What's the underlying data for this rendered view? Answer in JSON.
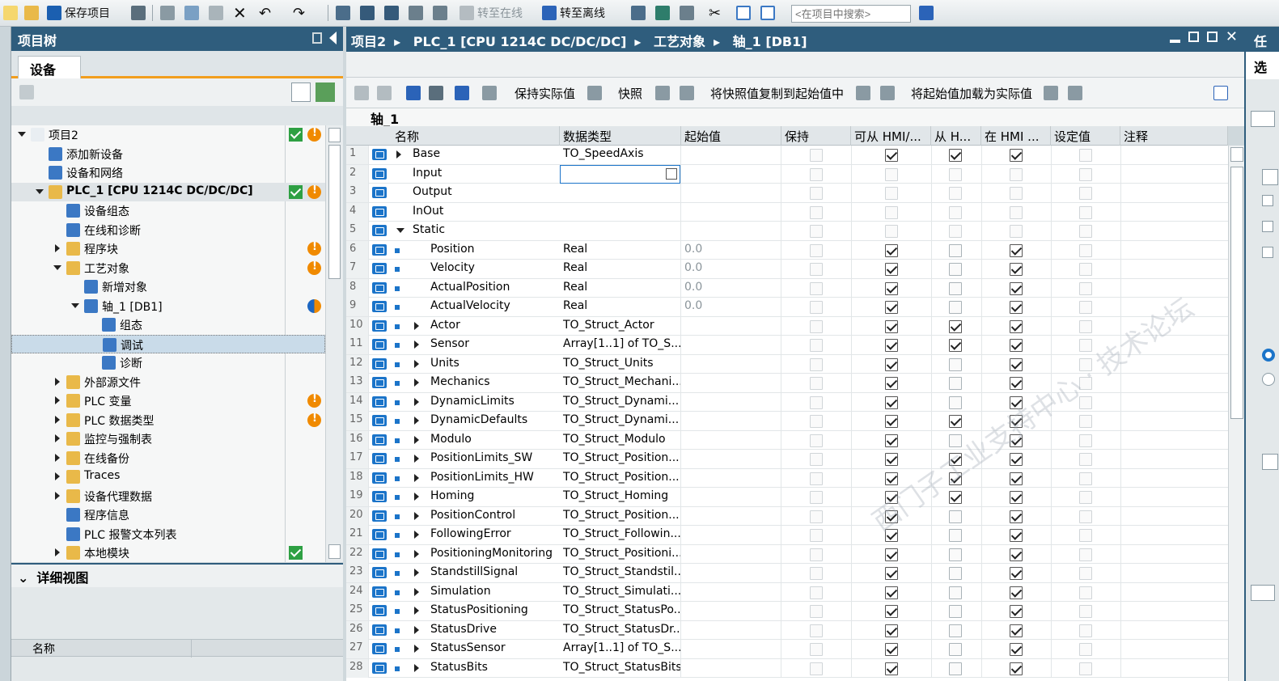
{
  "toolbar": {
    "save_project": "保存项目",
    "go_online": "转至在线",
    "go_offline": "转至离线",
    "search_placeholder": "<在项目中搜索>"
  },
  "project_tree": {
    "title": "项目树",
    "tab": "设备",
    "items": [
      {
        "label": "项目2",
        "level": 0,
        "expand": "down",
        "status": [
          "check",
          "warn"
        ]
      },
      {
        "label": "添加新设备",
        "level": 1,
        "expand": "none",
        "status": []
      },
      {
        "label": "设备和网络",
        "level": 1,
        "expand": "none",
        "status": []
      },
      {
        "label": "PLC_1 [CPU 1214C DC/DC/DC]",
        "level": 1,
        "expand": "down",
        "status": [
          "check",
          "warn"
        ]
      },
      {
        "label": "设备组态",
        "level": 2,
        "expand": "none",
        "status": []
      },
      {
        "label": "在线和诊断",
        "level": 2,
        "expand": "none",
        "status": []
      },
      {
        "label": "程序块",
        "level": 2,
        "expand": "right",
        "status": [
          "",
          "warn"
        ]
      },
      {
        "label": "工艺对象",
        "level": 2,
        "expand": "down",
        "status": [
          "",
          "warn"
        ]
      },
      {
        "label": "新增对象",
        "level": 3,
        "expand": "none",
        "status": []
      },
      {
        "label": "轴_1 [DB1]",
        "level": 3,
        "expand": "down",
        "status": [
          "",
          "half"
        ]
      },
      {
        "label": "组态",
        "level": 4,
        "expand": "none",
        "status": []
      },
      {
        "label": "调试",
        "level": 4,
        "expand": "none",
        "status": []
      },
      {
        "label": "诊断",
        "level": 4,
        "expand": "none",
        "status": []
      },
      {
        "label": "外部源文件",
        "level": 2,
        "expand": "right",
        "status": []
      },
      {
        "label": "PLC 变量",
        "level": 2,
        "expand": "right",
        "status": [
          "",
          "warn"
        ]
      },
      {
        "label": "PLC 数据类型",
        "level": 2,
        "expand": "right",
        "status": [
          "",
          "warn"
        ]
      },
      {
        "label": "监控与强制表",
        "level": 2,
        "expand": "right",
        "status": []
      },
      {
        "label": "在线备份",
        "level": 2,
        "expand": "right",
        "status": []
      },
      {
        "label": "Traces",
        "level": 2,
        "expand": "right",
        "status": []
      },
      {
        "label": "设备代理数据",
        "level": 2,
        "expand": "right",
        "status": []
      },
      {
        "label": "程序信息",
        "level": 2,
        "expand": "none",
        "status": []
      },
      {
        "label": "PLC 报警文本列表",
        "level": 2,
        "expand": "none",
        "status": []
      },
      {
        "label": "本地模块",
        "level": 2,
        "expand": "right",
        "status": [
          "check",
          ""
        ]
      }
    ],
    "selected_index": 11
  },
  "detail_view": {
    "title": "详细视图",
    "column_name": "名称"
  },
  "editor": {
    "breadcrumb": [
      "项目2",
      "PLC_1 [CPU 1214C DC/DC/DC]",
      "工艺对象",
      "轴_1 [DB1]"
    ],
    "toolbar": {
      "keep_actual": "保持实际值",
      "snapshot": "快照",
      "copy_snapshot": "将快照值复制到起始值中",
      "load_start": "将起始值加载为实际值"
    },
    "block_title": "轴_1",
    "columns": [
      "名称",
      "数据类型",
      "起始值",
      "保持",
      "可从 HMI/...",
      "从 H...",
      "在 HMI ...",
      "设定值",
      "注释"
    ],
    "rows": [
      {
        "n": "1",
        "name": "Base",
        "type": "TO_SpeedAxis",
        "start": "",
        "indent": 0,
        "expand": "right",
        "bullet": false,
        "hmi": [
          1,
          1,
          1
        ],
        "en": 1
      },
      {
        "n": "2",
        "name": "Input",
        "type": "",
        "start": "",
        "indent": 0,
        "expand": "none",
        "bullet": false,
        "hmi": [
          0,
          0,
          0
        ],
        "en": 0,
        "edit": true
      },
      {
        "n": "3",
        "name": "Output",
        "type": "",
        "start": "",
        "indent": 0,
        "expand": "none",
        "bullet": false,
        "hmi": [
          0,
          0,
          0
        ],
        "en": 0
      },
      {
        "n": "4",
        "name": "InOut",
        "type": "",
        "start": "",
        "indent": 0,
        "expand": "none",
        "bullet": false,
        "hmi": [
          0,
          0,
          0
        ],
        "en": 0
      },
      {
        "n": "5",
        "name": "Static",
        "type": "",
        "start": "",
        "indent": 0,
        "expand": "down",
        "bullet": false,
        "hmi": [
          0,
          0,
          0
        ],
        "en": 0
      },
      {
        "n": "6",
        "name": "Position",
        "type": "Real",
        "start": "0.0",
        "indent": 1,
        "expand": "none",
        "bullet": true,
        "hmi": [
          1,
          0,
          1
        ],
        "en": 1
      },
      {
        "n": "7",
        "name": "Velocity",
        "type": "Real",
        "start": "0.0",
        "indent": 1,
        "expand": "none",
        "bullet": true,
        "hmi": [
          1,
          0,
          1
        ],
        "en": 1
      },
      {
        "n": "8",
        "name": "ActualPosition",
        "type": "Real",
        "start": "0.0",
        "indent": 1,
        "expand": "none",
        "bullet": true,
        "hmi": [
          1,
          0,
          1
        ],
        "en": 1
      },
      {
        "n": "9",
        "name": "ActualVelocity",
        "type": "Real",
        "start": "0.0",
        "indent": 1,
        "expand": "none",
        "bullet": true,
        "hmi": [
          1,
          0,
          1
        ],
        "en": 1
      },
      {
        "n": "10",
        "name": "Actor",
        "type": "TO_Struct_Actor",
        "start": "",
        "indent": 1,
        "expand": "right",
        "bullet": true,
        "hmi": [
          1,
          1,
          1
        ],
        "en": 1
      },
      {
        "n": "11",
        "name": "Sensor",
        "type": "Array[1..1] of TO_S...",
        "start": "",
        "indent": 1,
        "expand": "right",
        "bullet": true,
        "hmi": [
          1,
          1,
          1
        ],
        "en": 1
      },
      {
        "n": "12",
        "name": "Units",
        "type": "TO_Struct_Units",
        "start": "",
        "indent": 1,
        "expand": "right",
        "bullet": true,
        "hmi": [
          1,
          0,
          1
        ],
        "en": 1
      },
      {
        "n": "13",
        "name": "Mechanics",
        "type": "TO_Struct_Mechani...",
        "start": "",
        "indent": 1,
        "expand": "right",
        "bullet": true,
        "hmi": [
          1,
          0,
          1
        ],
        "en": 1
      },
      {
        "n": "14",
        "name": "DynamicLimits",
        "type": "TO_Struct_Dynami...",
        "start": "",
        "indent": 1,
        "expand": "right",
        "bullet": true,
        "hmi": [
          1,
          0,
          1
        ],
        "en": 1
      },
      {
        "n": "15",
        "name": "DynamicDefaults",
        "type": "TO_Struct_Dynami...",
        "start": "",
        "indent": 1,
        "expand": "right",
        "bullet": true,
        "hmi": [
          1,
          1,
          1
        ],
        "en": 1
      },
      {
        "n": "16",
        "name": "Modulo",
        "type": "TO_Struct_Modulo",
        "start": "",
        "indent": 1,
        "expand": "right",
        "bullet": true,
        "hmi": [
          1,
          0,
          1
        ],
        "en": 1
      },
      {
        "n": "17",
        "name": "PositionLimits_SW",
        "type": "TO_Struct_Position...",
        "start": "",
        "indent": 1,
        "expand": "right",
        "bullet": true,
        "hmi": [
          1,
          1,
          1
        ],
        "en": 1
      },
      {
        "n": "18",
        "name": "PositionLimits_HW",
        "type": "TO_Struct_Position...",
        "start": "",
        "indent": 1,
        "expand": "right",
        "bullet": true,
        "hmi": [
          1,
          1,
          1
        ],
        "en": 1
      },
      {
        "n": "19",
        "name": "Homing",
        "type": "TO_Struct_Homing",
        "start": "",
        "indent": 1,
        "expand": "right",
        "bullet": true,
        "hmi": [
          1,
          1,
          1
        ],
        "en": 1
      },
      {
        "n": "20",
        "name": "PositionControl",
        "type": "TO_Struct_Position...",
        "start": "",
        "indent": 1,
        "expand": "right",
        "bullet": true,
        "hmi": [
          1,
          0,
          1
        ],
        "en": 1
      },
      {
        "n": "21",
        "name": "FollowingError",
        "type": "TO_Struct_Followin...",
        "start": "",
        "indent": 1,
        "expand": "right",
        "bullet": true,
        "hmi": [
          1,
          0,
          1
        ],
        "en": 1
      },
      {
        "n": "22",
        "name": "PositioningMonitoring",
        "type": "TO_Struct_Positioni...",
        "start": "",
        "indent": 1,
        "expand": "right",
        "bullet": true,
        "hmi": [
          1,
          0,
          1
        ],
        "en": 1
      },
      {
        "n": "23",
        "name": "StandstillSignal",
        "type": "TO_Struct_Standstil...",
        "start": "",
        "indent": 1,
        "expand": "right",
        "bullet": true,
        "hmi": [
          1,
          0,
          1
        ],
        "en": 1
      },
      {
        "n": "24",
        "name": "Simulation",
        "type": "TO_Struct_Simulati...",
        "start": "",
        "indent": 1,
        "expand": "right",
        "bullet": true,
        "hmi": [
          1,
          0,
          1
        ],
        "en": 1
      },
      {
        "n": "25",
        "name": "StatusPositioning",
        "type": "TO_Struct_StatusPo...",
        "start": "",
        "indent": 1,
        "expand": "right",
        "bullet": true,
        "hmi": [
          1,
          0,
          1
        ],
        "en": 1
      },
      {
        "n": "26",
        "name": "StatusDrive",
        "type": "TO_Struct_StatusDr...",
        "start": "",
        "indent": 1,
        "expand": "right",
        "bullet": true,
        "hmi": [
          1,
          0,
          1
        ],
        "en": 1
      },
      {
        "n": "27",
        "name": "StatusSensor",
        "type": "Array[1..1] of TO_S...",
        "start": "",
        "indent": 1,
        "expand": "right",
        "bullet": true,
        "hmi": [
          1,
          0,
          1
        ],
        "en": 1
      },
      {
        "n": "28",
        "name": "StatusBits",
        "type": "TO_Struct_StatusBits",
        "start": "",
        "indent": 1,
        "expand": "right",
        "bullet": true,
        "hmi": [
          1,
          0,
          1
        ],
        "en": 1
      }
    ]
  },
  "right_pane": {
    "title": "任",
    "subtitle": "选"
  },
  "colors": {
    "header_blue": "#2f5d7d",
    "accent_orange": "#f29e1e",
    "icon_blue": "#1b74c9"
  }
}
